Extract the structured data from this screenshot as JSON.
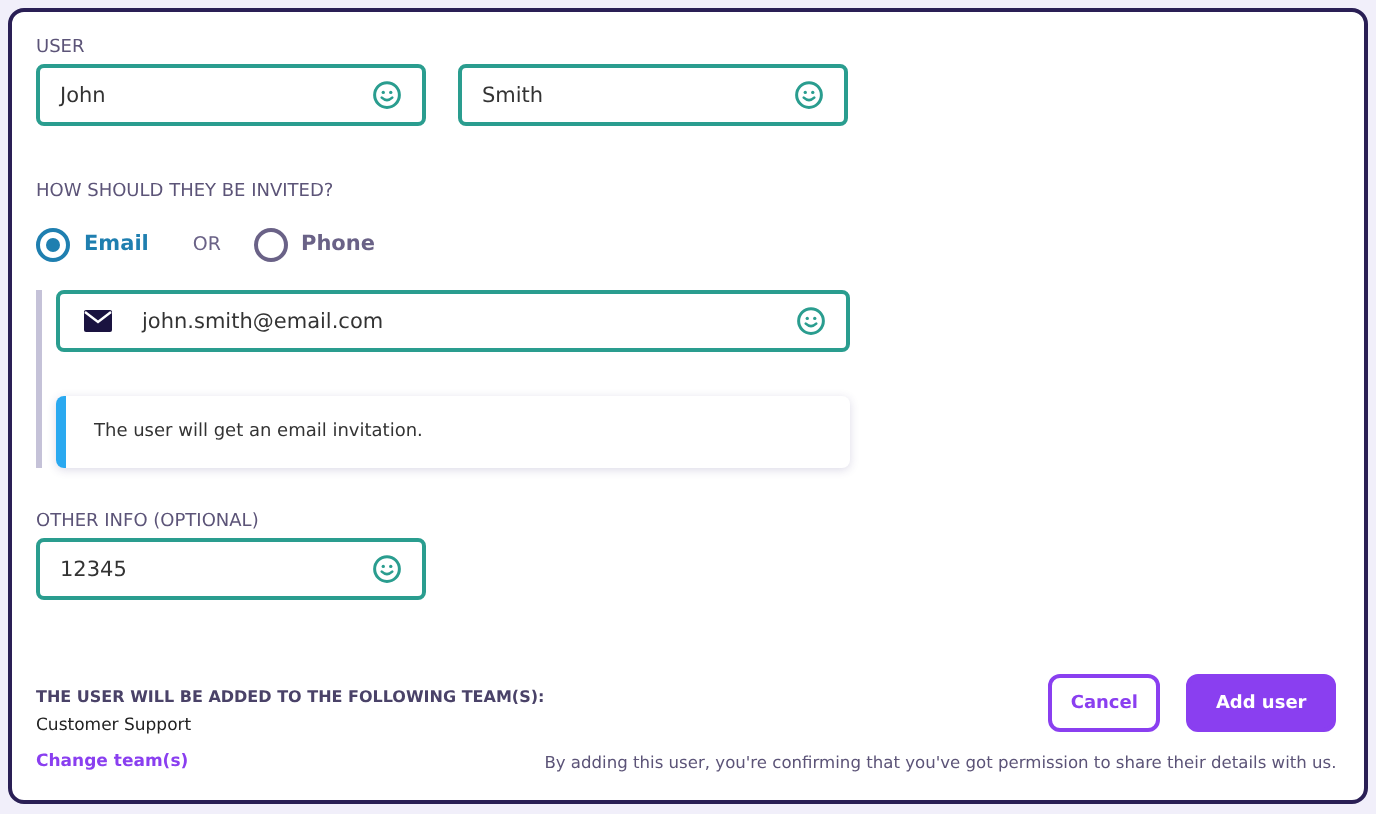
{
  "user": {
    "label": "USER",
    "fields": [
      {
        "value": "John"
      },
      {
        "value": "Smith"
      }
    ]
  },
  "invite": {
    "label": "HOW SHOULD THEY BE INVITED?",
    "options": [
      {
        "label": "Email",
        "selected": true
      },
      {
        "label": "Phone",
        "selected": false
      }
    ],
    "separator": "OR",
    "email_field": {
      "value": "john.smith@email.com"
    },
    "notice": "The user will get an email invitation."
  },
  "other_info": {
    "label": "OTHER INFO (OPTIONAL)",
    "value": "12345"
  },
  "teams": {
    "label": "THE USER WILL BE ADDED TO THE FOLLOWING TEAM(S):",
    "team": "Customer Support",
    "change_link": "Change team(s)"
  },
  "buttons": [
    {
      "label": "Cancel",
      "kind": "secondary"
    },
    {
      "label": "Add user",
      "kind": "primary"
    }
  ],
  "disclaimer": "By adding this user, you're confirming that you've got permission to share their details with us."
}
